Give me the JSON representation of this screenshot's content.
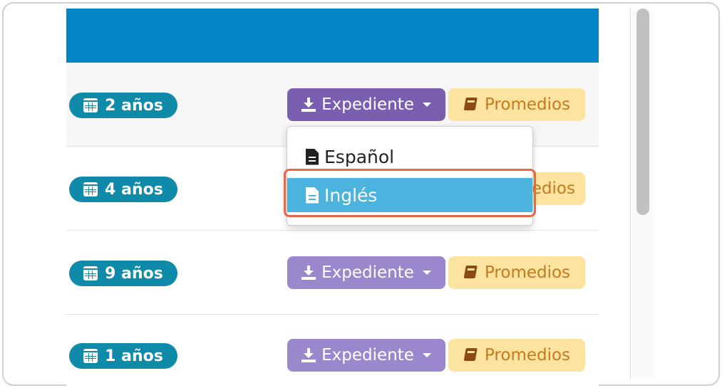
{
  "rows": [
    {
      "age": "2 años",
      "expediente_label": "Expediente",
      "promedios_label": "Promedios"
    },
    {
      "age": "4 años",
      "promedios_partial": "edios"
    },
    {
      "age": "9 años",
      "expediente_label": "Expediente",
      "promedios_label": "Promedios"
    },
    {
      "age": "1 años",
      "expediente_label": "Expediente",
      "promedios_label": "Promedios"
    }
  ],
  "dropdown": {
    "items": [
      {
        "label": "Español"
      },
      {
        "label": "Inglés"
      }
    ],
    "highlighted": "Inglés"
  },
  "colors": {
    "header": "#0284c7",
    "age_badge": "#0f8aa8",
    "expediente_button": "#9b87cb",
    "expediente_button_active": "#7a5fb0",
    "promedios_button": "#fde3a0",
    "dropdown_highlight": "#4cb3df",
    "focus_ring": "#e8674a"
  },
  "icons": {
    "age_badge": "calendar-icon",
    "expediente": "download-icon",
    "promedios": "book-icon",
    "dropdown_items": "file-icon"
  }
}
